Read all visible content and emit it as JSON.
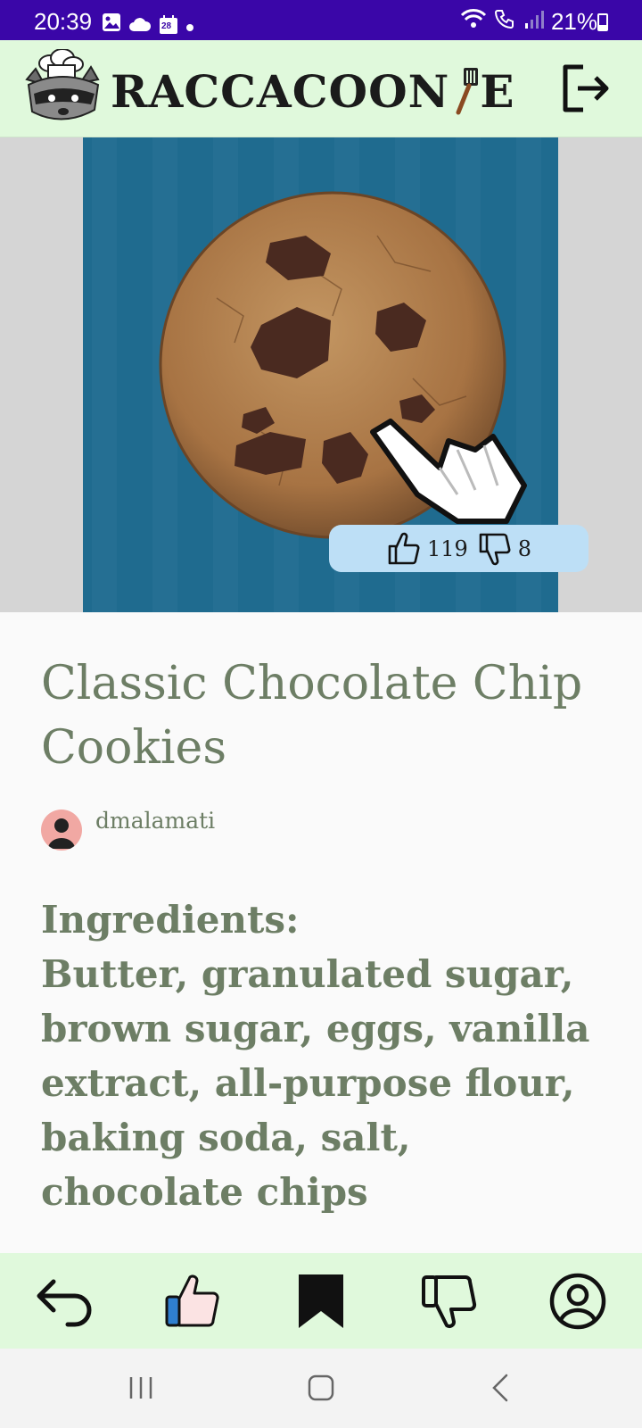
{
  "status_bar": {
    "time": "20:39",
    "calendar_day": "28",
    "battery_percent": "21%",
    "icons": [
      "image-icon",
      "cloud-icon",
      "calendar-icon",
      "dot-icon",
      "wifi-icon",
      "wifi-calling-icon",
      "signal-icon",
      "battery-icon"
    ]
  },
  "header": {
    "app_name_part1": "RACCACOON",
    "app_name_part2": "E",
    "logo": "raccoon-chef-logo",
    "logout_icon": "logout-icon"
  },
  "recipe": {
    "image": "cookie-image",
    "likes": "119",
    "dislikes": "8",
    "title": "Classic Chocolate Chip Cookies",
    "author": "dmalamati",
    "ingredients_label": "Ingredients:",
    "ingredients": "Butter, granulated sugar, brown sugar, eggs, vanilla extract, all-purpose flour, baking soda, salt, chocolate chips"
  },
  "bottom_nav": [
    "back-icon",
    "like-icon",
    "bookmark-icon",
    "dislike-icon",
    "profile-icon"
  ],
  "system_nav": [
    "recent-apps-icon",
    "home-icon",
    "back-icon"
  ],
  "colors": {
    "status_bar": "#3a06a8",
    "header_bg": "#e0f9dc",
    "text_green": "#6d7e65",
    "vote_pill": "#bddff6",
    "avatar_bg": "#f1a8a3",
    "image_bg": "#1f6b8f"
  }
}
